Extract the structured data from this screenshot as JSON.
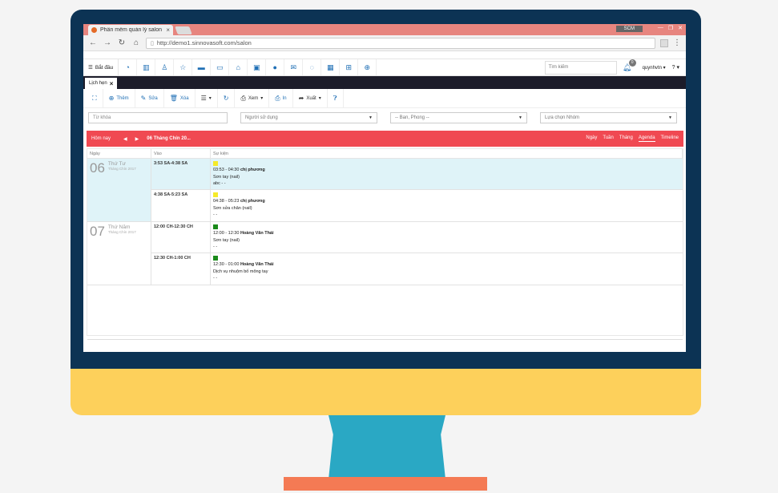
{
  "browser": {
    "tab_title": "Phần mềm quản lý salon",
    "tab_close": "×",
    "window_badge": "SCM",
    "url": "http://demo1.sinnovasoft.com/salon"
  },
  "toolbar": {
    "start_label": "Bắt đầu",
    "search_placeholder": "Tìm kiếm",
    "notification_count": "0",
    "user_label": "quynhvtn",
    "help_label": "?"
  },
  "module": {
    "tab_label": "Lịch hẹn",
    "close_label": "×"
  },
  "actions": {
    "add_label": "Thêm",
    "edit_label": "Sửa",
    "delete_label": "Xóa",
    "view_label": "Xem",
    "print_label": "In",
    "export_label": "Xuất"
  },
  "filters": {
    "keyword_placeholder": "Từ khóa",
    "user_placeholder": "Người sử dụng",
    "department_placeholder": "-- Ban, Phong --",
    "group_placeholder": "Lựa chọn Nhóm"
  },
  "calendar": {
    "today_label": "Hôm nay",
    "prev_label": "◀",
    "next_label": "▶",
    "range_label": "06 Tháng Chín 20...",
    "views": [
      "Ngày",
      "Tuần",
      "Tháng",
      "Agenda",
      "Timeline"
    ],
    "active_view": "Agenda",
    "headers": {
      "day": "Ngày",
      "time": "Vào",
      "event": "Sự kiện"
    }
  },
  "agenda": [
    {
      "day_num": "06",
      "weekday": "Thứ Tư",
      "month": "Tháng Chín 2017",
      "highlight": true,
      "events": [
        {
          "time": "3:53 SA-4:38 SA",
          "color": "#f5ea2a",
          "title_time": "03:53 - 04:30",
          "title_name": "chị phương",
          "service": "Sơn tay (nail)",
          "note": "abc - -",
          "highlight": true
        },
        {
          "time": "4:38 SA-5:23 SA",
          "color": "#f5ea2a",
          "title_time": "04:38 - 05:23",
          "title_name": "chị phương",
          "service": "Sơn sửa chân (nail)",
          "note": "- -",
          "highlight": false
        }
      ]
    },
    {
      "day_num": "07",
      "weekday": "Thứ Năm",
      "month": "Tháng Chín 2017",
      "highlight": false,
      "events": [
        {
          "time": "12:00 CH-12:30 CH",
          "color": "#1a8a1a",
          "title_time": "12:00 - 12:30",
          "title_name": "Hoàng Văn Thái",
          "service": "Sơn tay (nail)",
          "note": "- -",
          "highlight": false
        },
        {
          "time": "12:30 CH-1:00 CH",
          "color": "#1a8a1a",
          "title_time": "12:30 - 01:00",
          "title_name": "Hoàng Văn Thái",
          "service": "Dịch vụ nhuộm bố mông tay",
          "note": "- -",
          "highlight": false
        }
      ]
    }
  ]
}
